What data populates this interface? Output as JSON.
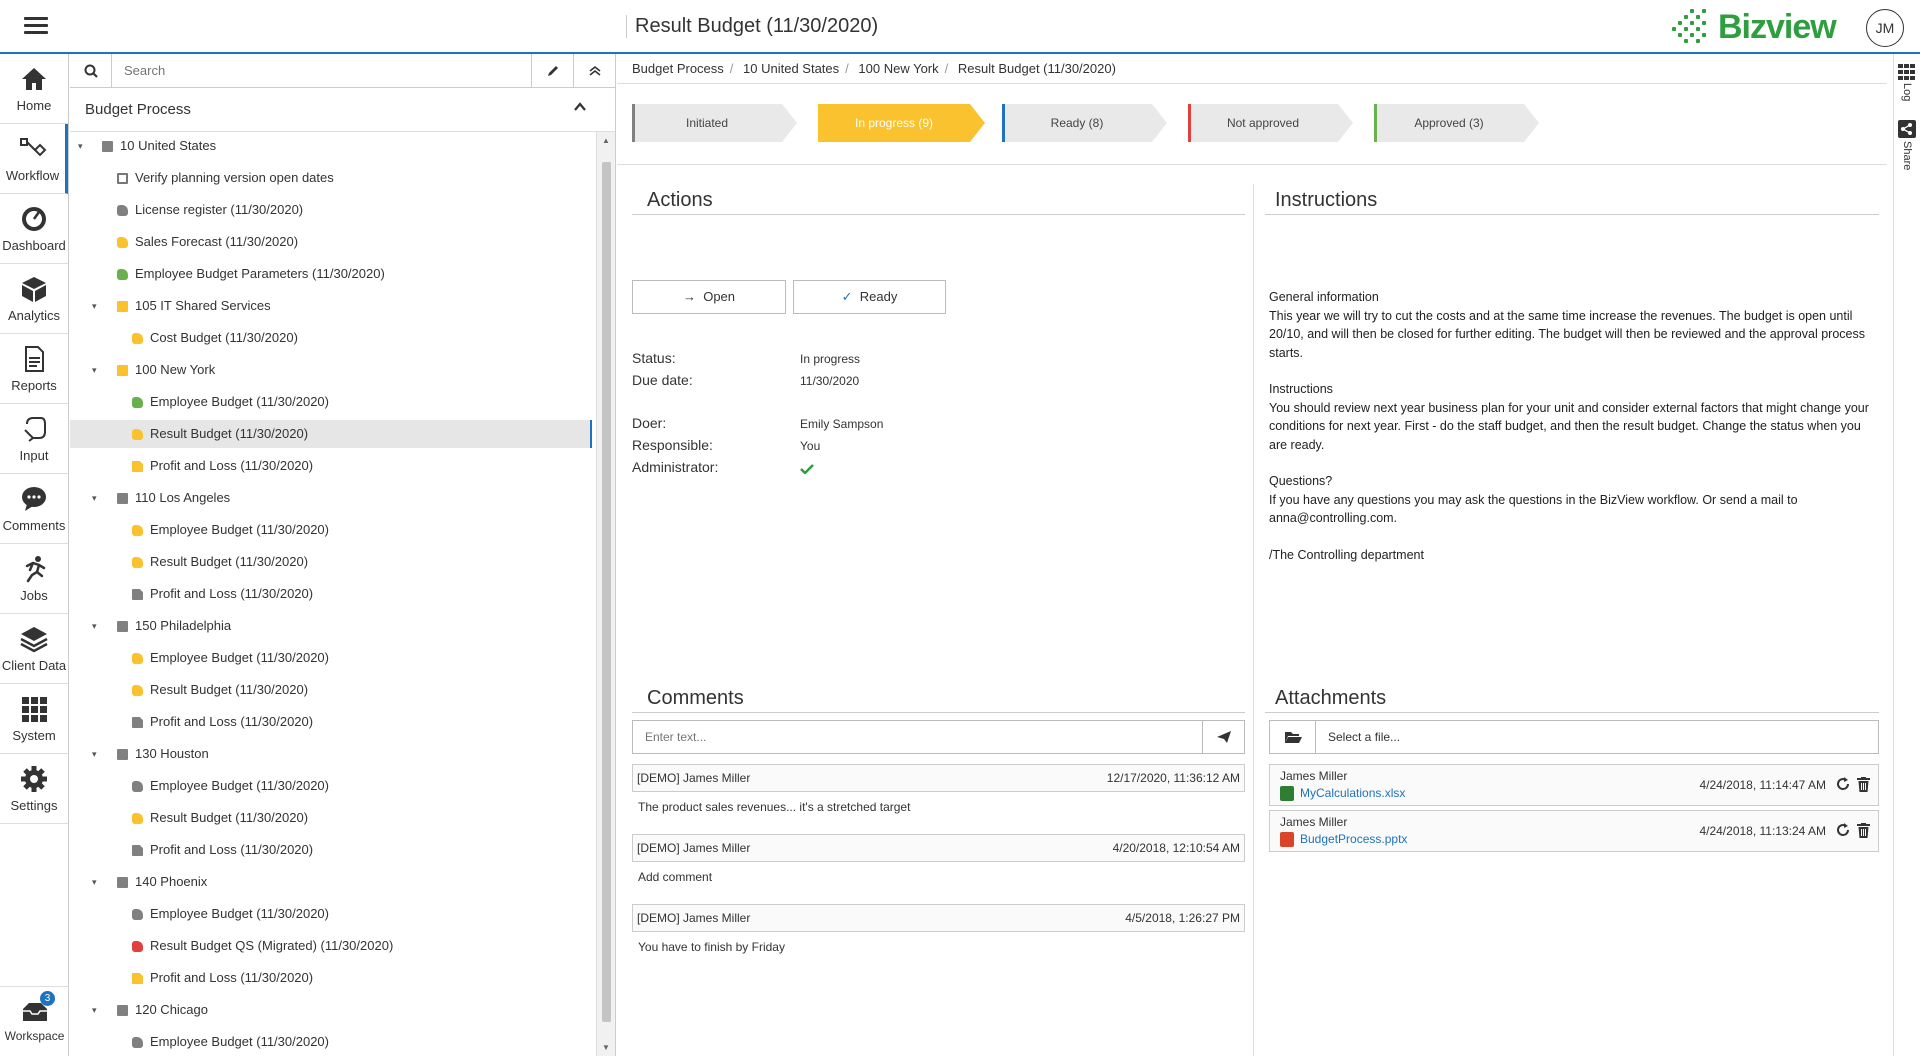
{
  "header": {
    "page_title": "Result Budget (11/30/2020)",
    "logo_text": "Bizview",
    "avatar_initials": "JM",
    "brand_color": "#2e9e3e",
    "accent_color": "#1e73be"
  },
  "leftnav": {
    "items": [
      {
        "label": "Home",
        "icon": "home-icon"
      },
      {
        "label": "Workflow",
        "icon": "workflow-icon"
      },
      {
        "label": "Dashboard",
        "icon": "gauge-icon"
      },
      {
        "label": "Analytics",
        "icon": "cube-icon"
      },
      {
        "label": "Reports",
        "icon": "report-icon"
      },
      {
        "label": "Input",
        "icon": "input-icon"
      },
      {
        "label": "Comments",
        "icon": "comment-icon"
      },
      {
        "label": "Jobs",
        "icon": "runner-icon"
      },
      {
        "label": "Client Data",
        "icon": "layers-icon"
      },
      {
        "label": "System",
        "icon": "grid-icon"
      },
      {
        "label": "Settings",
        "icon": "gear-icon"
      }
    ],
    "workspace_label": "Workspace",
    "workspace_badge": "3"
  },
  "search": {
    "placeholder": "Search"
  },
  "tree": {
    "header": "Budget Process",
    "items": [
      {
        "label": "10 United States",
        "level": 0,
        "kind": "folder",
        "color": "#808080",
        "caret": true
      },
      {
        "label": "Verify planning version open dates",
        "level": 1,
        "kind": "check",
        "color": "#777777",
        "caret": false
      },
      {
        "label": "License register (11/30/2020)",
        "level": 1,
        "kind": "hand",
        "color": "#808080",
        "caret": false
      },
      {
        "label": "Sales Forecast (11/30/2020)",
        "level": 1,
        "kind": "hand",
        "color": "#f9c22e",
        "caret": false
      },
      {
        "label": "Employee Budget Parameters (11/30/2020)",
        "level": 1,
        "kind": "hand",
        "color": "#6ab04c",
        "caret": false
      },
      {
        "label": "105 IT Shared Services",
        "level": 1,
        "kind": "folder",
        "color": "#f9c22e",
        "caret": true
      },
      {
        "label": "Cost Budget (11/30/2020)",
        "level": 2,
        "kind": "hand",
        "color": "#f9c22e",
        "caret": false
      },
      {
        "label": "100 New York",
        "level": 1,
        "kind": "folder",
        "color": "#f9c22e",
        "caret": true
      },
      {
        "label": "Employee Budget (11/30/2020)",
        "level": 2,
        "kind": "hand",
        "color": "#6ab04c",
        "caret": false
      },
      {
        "label": "Result Budget (11/30/2020)",
        "level": 2,
        "kind": "hand",
        "color": "#f9c22e",
        "caret": false,
        "selected": true
      },
      {
        "label": "Profit and Loss (11/30/2020)",
        "level": 2,
        "kind": "doc",
        "color": "#f9c22e",
        "caret": false
      },
      {
        "label": "110 Los Angeles",
        "level": 1,
        "kind": "folder",
        "color": "#808080",
        "caret": true
      },
      {
        "label": "Employee Budget (11/30/2020)",
        "level": 2,
        "kind": "hand",
        "color": "#f9c22e",
        "caret": false
      },
      {
        "label": "Result Budget (11/30/2020)",
        "level": 2,
        "kind": "hand",
        "color": "#f9c22e",
        "caret": false
      },
      {
        "label": "Profit and Loss (11/30/2020)",
        "level": 2,
        "kind": "doc",
        "color": "#808080",
        "caret": false
      },
      {
        "label": "150 Philadelphia",
        "level": 1,
        "kind": "folder",
        "color": "#808080",
        "caret": true
      },
      {
        "label": "Employee Budget (11/30/2020)",
        "level": 2,
        "kind": "hand",
        "color": "#f9c22e",
        "caret": false
      },
      {
        "label": "Result Budget (11/30/2020)",
        "level": 2,
        "kind": "hand",
        "color": "#f9c22e",
        "caret": false
      },
      {
        "label": "Profit and Loss (11/30/2020)",
        "level": 2,
        "kind": "doc",
        "color": "#808080",
        "caret": false
      },
      {
        "label": "130 Houston",
        "level": 1,
        "kind": "folder",
        "color": "#808080",
        "caret": true
      },
      {
        "label": "Employee Budget (11/30/2020)",
        "level": 2,
        "kind": "hand",
        "color": "#808080",
        "caret": false
      },
      {
        "label": "Result Budget (11/30/2020)",
        "level": 2,
        "kind": "hand",
        "color": "#f9c22e",
        "caret": false
      },
      {
        "label": "Profit and Loss (11/30/2020)",
        "level": 2,
        "kind": "doc",
        "color": "#808080",
        "caret": false
      },
      {
        "label": "140 Phoenix",
        "level": 1,
        "kind": "folder",
        "color": "#808080",
        "caret": true
      },
      {
        "label": "Employee Budget (11/30/2020)",
        "level": 2,
        "kind": "hand",
        "color": "#808080",
        "caret": false
      },
      {
        "label": "Result Budget QS (Migrated) (11/30/2020)",
        "level": 2,
        "kind": "hand",
        "color": "#e04040",
        "caret": false
      },
      {
        "label": "Profit and Loss (11/30/2020)",
        "level": 2,
        "kind": "doc",
        "color": "#f9c22e",
        "caret": false
      },
      {
        "label": "120 Chicago",
        "level": 1,
        "kind": "folder",
        "color": "#808080",
        "caret": true
      },
      {
        "label": "Employee Budget (11/30/2020)",
        "level": 2,
        "kind": "hand",
        "color": "#808080",
        "caret": false
      }
    ]
  },
  "breadcrumb": [
    "Budget Process",
    "10 United States",
    "100 New York",
    "Result Budget (11/30/2020)"
  ],
  "stages": [
    {
      "label": "Initiated",
      "color": "#808080",
      "current": false
    },
    {
      "label": "In progress (9)",
      "color": "#f9c22e",
      "current": true
    },
    {
      "label": "Ready (8)",
      "color": "#1e73be",
      "current": false
    },
    {
      "label": "Not approved",
      "color": "#e04040",
      "current": false
    },
    {
      "label": "Approved (3)",
      "color": "#6ab04c",
      "current": false
    }
  ],
  "actions": {
    "title": "Actions",
    "open_label": "Open",
    "ready_label": "Ready",
    "status_label": "Status:",
    "status_value": "In progress",
    "due_label": "Due date:",
    "due_value": "11/30/2020",
    "doer_label": "Doer:",
    "doer_value": "Emily Sampson",
    "responsible_label": "Responsible:",
    "responsible_value": "You",
    "administrator_label": "Administrator:"
  },
  "instructions": {
    "title": "Instructions",
    "paragraphs": [
      "General information\nThis year we will try to cut the costs and at the same time increase the revenues. The budget is open until 20/10, and will then be closed for further editing. The budget will then be reviewed and the approval process starts.",
      "Instructions\nYou should review next year business plan for your unit and consider external factors that might change your conditions for next year. First - do the staff budget, and then the result budget. Change the status when you are ready.",
      "Questions?\nIf you have any questions you may ask the questions in the BizView workflow. Or send a mail to anna@controlling.com.",
      "/The Controlling department"
    ]
  },
  "comments": {
    "title": "Comments",
    "placeholder": "Enter text...",
    "items": [
      {
        "author": "[DEMO] James Miller",
        "date": "12/17/2020, 11:36:12 AM",
        "text": "The product sales revenues... it's a stretched target"
      },
      {
        "author": "[DEMO] James Miller",
        "date": "4/20/2018, 12:10:54 AM",
        "text": "Add comment"
      },
      {
        "author": "[DEMO] James Miller",
        "date": "4/5/2018, 1:26:27 PM",
        "text": "You have to finish by Friday"
      }
    ]
  },
  "attachments": {
    "title": "Attachments",
    "select_label": "Select a file...",
    "items": [
      {
        "author": "James Miller",
        "file": "MyCalculations.xlsx",
        "date": "4/24/2018, 11:14:47 AM",
        "icon_color": "#2e7d32"
      },
      {
        "author": "James Miller",
        "file": "BudgetProcess.pptx",
        "date": "4/24/2018, 11:13:24 AM",
        "icon_color": "#d9442b"
      }
    ]
  },
  "rightstrip": {
    "log_label": "Log",
    "share_label": "Share"
  }
}
